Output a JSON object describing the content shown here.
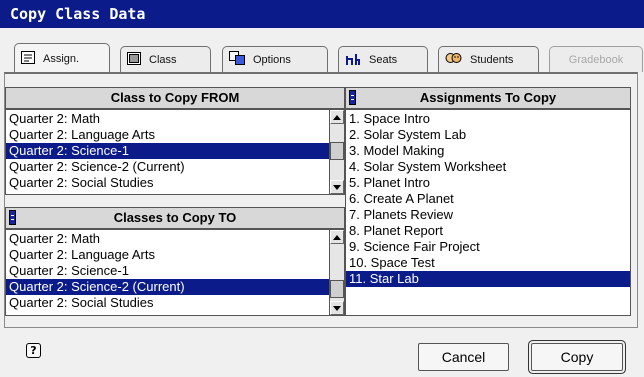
{
  "window": {
    "title": "Copy Class Data"
  },
  "tabs": [
    {
      "label": "Assign.",
      "icon": "assign-icon"
    },
    {
      "label": "Class",
      "icon": "class-icon"
    },
    {
      "label": "Options",
      "icon": "options-icon"
    },
    {
      "label": "Seats",
      "icon": "seats-icon"
    },
    {
      "label": "Students",
      "icon": "students-icon"
    },
    {
      "label": "Gradebook",
      "icon": ""
    }
  ],
  "active_tab": "Assign.",
  "copy_from": {
    "header": "Class to Copy FROM",
    "items": [
      "Quarter 2: Math",
      "Quarter 2: Language Arts",
      "Quarter 2: Science-1",
      "Quarter 2: Science-2 (Current)",
      "Quarter 2: Social Studies"
    ],
    "selected": "Quarter 2: Science-1"
  },
  "copy_to": {
    "header": "Classes to Copy TO",
    "items": [
      "Quarter 2: Math",
      "Quarter 2: Language Arts",
      "Quarter 2: Science-1",
      "Quarter 2: Science-2 (Current)",
      "Quarter 2: Social Studies"
    ],
    "selected": "Quarter 2: Science-2 (Current)"
  },
  "assignments": {
    "header": "Assignments To Copy",
    "items": [
      "1. Space Intro",
      "2. Solar System Lab",
      "3. Model Making",
      "4. Solar System Worksheet",
      "5. Planet Intro",
      "6. Create A Planet",
      "7. Planets Review",
      "8. Planet Report",
      "9. Science Fair Project",
      "10. Space Test",
      "11. Star Lab"
    ],
    "selected": "11. Star Lab"
  },
  "footer": {
    "help_label": "?",
    "cancel_label": "Cancel",
    "copy_label": "Copy"
  },
  "colors": {
    "titlebar": "#0b1c8a",
    "selection": "#0b1c8a",
    "selection_text": "#ffffff"
  }
}
